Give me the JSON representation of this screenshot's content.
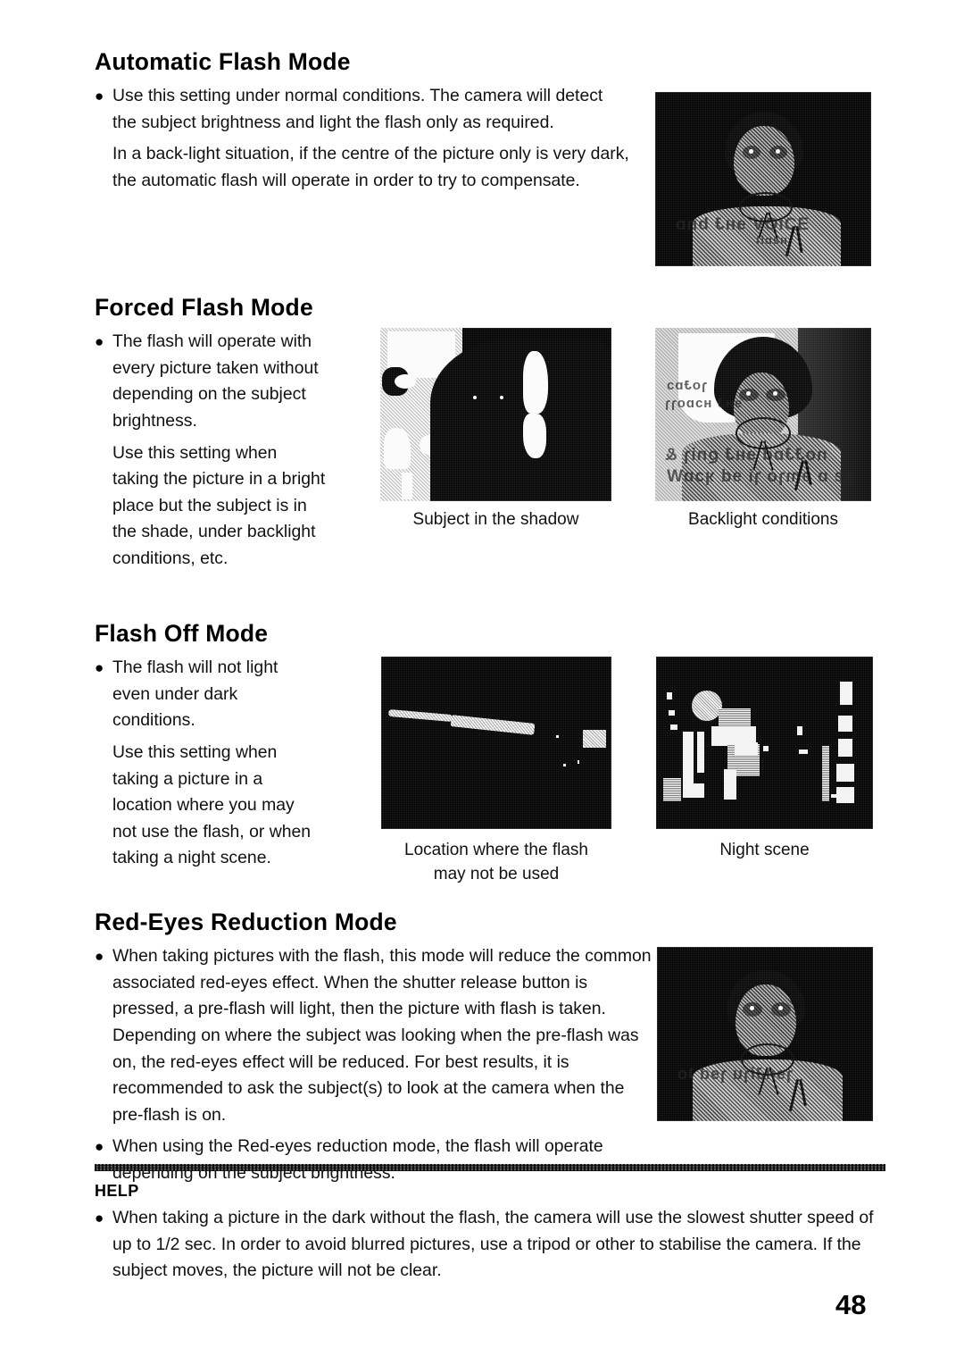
{
  "page": {
    "number": "48"
  },
  "sections": [
    {
      "heading": "Automatic Flash Mode",
      "paragraphs": [
        "Use this setting under normal conditions. The camera will detect the subject brightness and light the flash only as required.",
        "In a back-light situation, if the centre of the picture only is very dark, the automatic flash will operate in order to try to compensate."
      ]
    },
    {
      "heading": "Forced Flash Mode",
      "paragraphs": [
        "The flash will operate with every picture taken without depending on the subject brightness.",
        "Use this setting when taking the picture in a bright place but the subject is in the shade, under backlight conditions, etc."
      ]
    },
    {
      "heading": "Flash Off Mode",
      "paragraphs": [
        "The flash will not light even under dark conditions.",
        "Use this setting when taking a picture in a location where you may not use the flash, or when taking a night scene."
      ]
    },
    {
      "heading": "Red-Eyes Reduction Mode",
      "paragraphs": [
        "When taking pictures with the flash, this mode will reduce the common associated red-eyes effect. When the shutter release button is pressed, a pre-flash will light, then the picture with flash is taken. Depending on where the subject was looking when the pre-flash was on, the red-eyes effect will be reduced. For best results, it is recommended to ask the subject(s) to look at the camera when the pre-flash is on.",
        "When using the Red-eyes reduction mode, the flash will operate depending on the subject brightness."
      ]
    }
  ],
  "figures": {
    "auto_flash_portrait": {
      "alt": "portrait-photo-dark-background"
    },
    "forced_shadow": {
      "alt": "silhouette-photo-subject-backlit"
    },
    "forced_backlight": {
      "alt": "portrait-photo-backlit-window"
    },
    "flashoff_location": {
      "alt": "dark-interior-photo"
    },
    "flashoff_night": {
      "alt": "night-city-street-photo"
    },
    "redeye_portrait": {
      "alt": "portrait-photo-red-eye-reduction"
    }
  },
  "captions": {
    "subject_shadow": "Subject in the shadow",
    "backlight_conditions": "Backlight conditions",
    "location_no_flash_l1": "Location where  the flash",
    "location_no_flash_l2": "may not be used",
    "night_scene": "Night scene"
  },
  "help": {
    "label": "HELP",
    "text": "When taking a picture in the dark without the flash, the camera will use the slowest shutter speed of up to 1/2 sec. In order to avoid blurred pictures, use a tripod or other to stabilise the camera. If the subject moves, the picture will not be clear."
  },
  "bullet_glyph": "●"
}
